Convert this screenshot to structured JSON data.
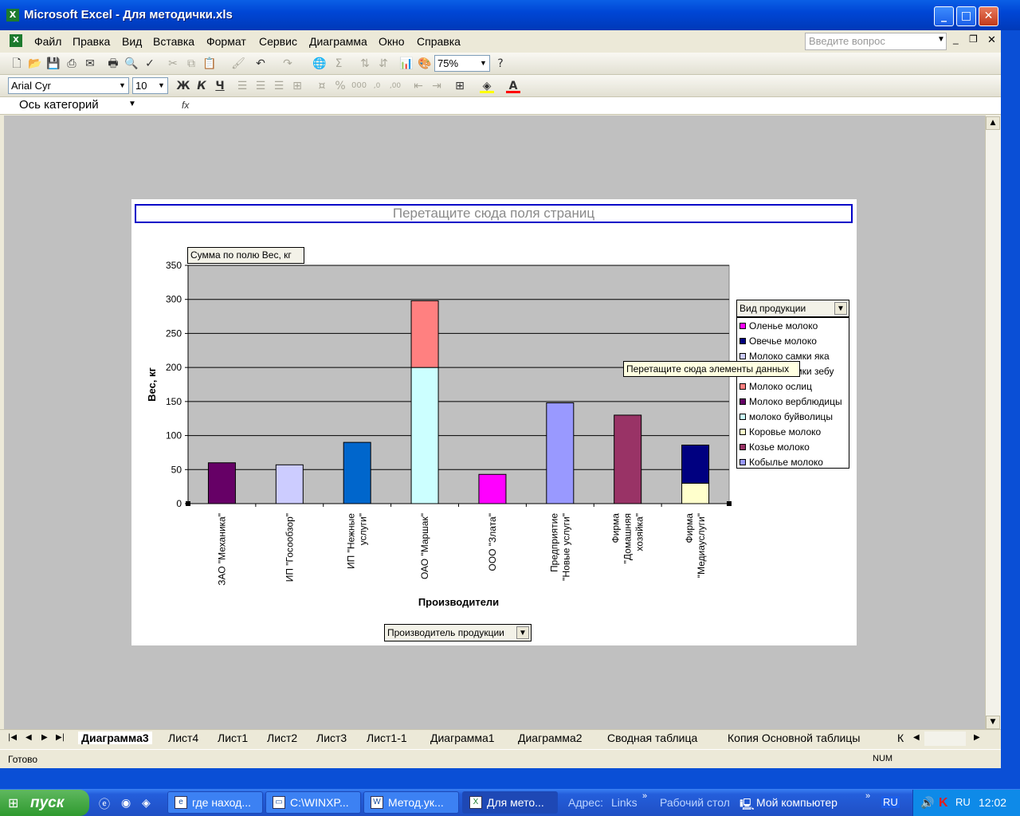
{
  "window": {
    "title": "Microsoft Excel - Для методички.xls"
  },
  "menu": {
    "items": [
      "Файл",
      "Правка",
      "Вид",
      "Вставка",
      "Формат",
      "Сервис",
      "Диаграмма",
      "Окно",
      "Справка"
    ],
    "help_placeholder": "Введите вопрос"
  },
  "toolbar": {
    "zoom": "75%",
    "font": "Arial Cyr",
    "font_size": "10",
    "bold": "Ж",
    "italic": "К",
    "underline": "Ч"
  },
  "formula": {
    "name_box": "Ось категорий",
    "fx": "fx"
  },
  "chart": {
    "page_drop": "Перетащите сюда поля страниц",
    "data_field": "Сумма по полю Вес, кг",
    "series_drop": "Вид продукции",
    "category_drop": "Производитель продукции",
    "tooltip": "Перетащите сюда элементы данных"
  },
  "chart_data": {
    "type": "bar",
    "stacked": true,
    "xlabel": "Производители",
    "ylabel": "Вес, кг",
    "ylim": [
      0,
      350
    ],
    "yticks": [
      0,
      50,
      100,
      150,
      200,
      250,
      300,
      350
    ],
    "grid": true,
    "legend_position": "right",
    "categories": [
      "ЗАО \"Механика\"",
      "ИП \"Госообзор\"",
      "ИП \"Нежные услуги\"",
      "ОАО \"Маршак\"",
      "ООО \"Злата\"",
      "Предприятие \"Новые услуги\"",
      "Фирма \"Домашняя хозяйка\"",
      "Фирма \"Медиауслуги\""
    ],
    "category_lines": [
      [
        "ЗАО \"Механика\""
      ],
      [
        "ИП \"Госообзор\""
      ],
      [
        "ИП \"Нежные",
        "услуги\""
      ],
      [
        "ОАО \"Маршак\""
      ],
      [
        "ООО \"Злата\""
      ],
      [
        "Предприятие",
        "\"Новые услуги\""
      ],
      [
        "Фирма",
        "\"Домашняя",
        "хозяйка\""
      ],
      [
        "Фирма",
        "\"Медиауслуги\""
      ]
    ],
    "series": [
      {
        "name": "Оленье молоко",
        "color": "#ff00ff",
        "values": [
          0,
          0,
          0,
          0,
          43,
          0,
          0,
          0
        ]
      },
      {
        "name": "Овечье молоко",
        "color": "#000080",
        "values": [
          0,
          0,
          0,
          0,
          0,
          0,
          0,
          56
        ]
      },
      {
        "name": "Молоко самки яка",
        "color": "#ccccff",
        "values": [
          0,
          57,
          0,
          0,
          0,
          0,
          0,
          0
        ]
      },
      {
        "name": "Молоко самки зебу",
        "color": "#0066cc",
        "values": [
          0,
          0,
          90,
          0,
          0,
          0,
          0,
          0
        ]
      },
      {
        "name": "Молоко ослиц",
        "color": "#ff8080",
        "values": [
          0,
          0,
          0,
          98,
          0,
          0,
          0,
          0
        ]
      },
      {
        "name": "Молоко верблюдицы",
        "color": "#660066",
        "values": [
          60,
          0,
          0,
          0,
          0,
          0,
          0,
          0
        ]
      },
      {
        "name": "молоко буйволицы",
        "color": "#ccffff",
        "values": [
          0,
          0,
          0,
          200,
          0,
          0,
          0,
          0
        ]
      },
      {
        "name": "Коровье молоко",
        "color": "#ffffcc",
        "values": [
          0,
          0,
          0,
          0,
          0,
          0,
          0,
          30
        ]
      },
      {
        "name": "Козье молоко",
        "color": "#993366",
        "values": [
          0,
          0,
          0,
          0,
          0,
          0,
          130,
          0
        ]
      },
      {
        "name": "Кобылье молоко",
        "color": "#9999ff",
        "values": [
          0,
          0,
          0,
          0,
          0,
          148,
          0,
          0
        ]
      }
    ],
    "stack_order": [
      "молоко буйволицы",
      "Коровье молоко",
      "Овечье молоко",
      "Молоко ослиц",
      "Молоко верблюдицы",
      "Молоко самки яка",
      "Молоко самки зебу",
      "Оленье молоко",
      "Кобылье молоко",
      "Козье молоко"
    ]
  },
  "sheets": {
    "tabs": [
      "Диаграмма3",
      "Лист4",
      "Лист1",
      "Лист2",
      "Лист3",
      "Лист1-1",
      "Диаграмма1",
      "Диаграмма2",
      "Сводная таблица",
      "Копия Основной таблицы",
      "К"
    ],
    "active": "Диаграмма3"
  },
  "status": {
    "text": "Готово",
    "num": "NUM"
  },
  "taskbar": {
    "start": "пуск",
    "tasks": [
      "где наход...",
      "C:\\WINXP...",
      "Метод.ук...",
      "Для мето..."
    ],
    "address_label": "Адрес:",
    "links": "Links",
    "desktop": "Рабочий стол",
    "my_computer": "Мой компьютер",
    "lang": "RU",
    "clock": "12:02"
  }
}
